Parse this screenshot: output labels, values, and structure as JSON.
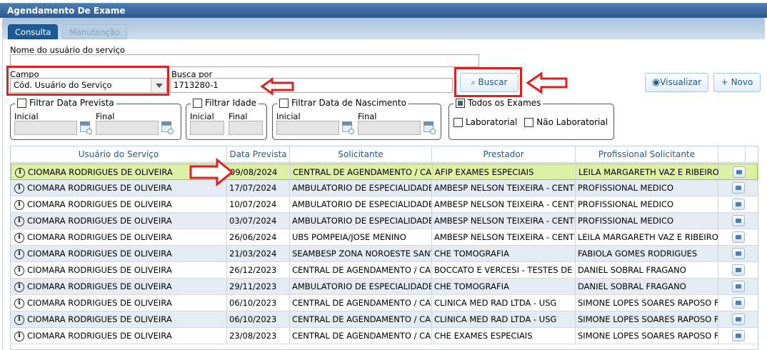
{
  "window": {
    "title": "Agendamento De Exame"
  },
  "tabs": [
    {
      "label": "Consulta"
    },
    {
      "label": "Manutenção"
    }
  ],
  "form": {
    "user_name_label": "Nome do usuário do serviço",
    "user_name_value": "",
    "campo_label": "Campo",
    "campo_value": "Cód. Usuário do Serviço",
    "busca_label": "Busca por",
    "busca_value": "1713280-1",
    "buscar_button": "Buscar",
    "visualizar_button": "Visualizar",
    "novo_button": "Novo"
  },
  "filters": {
    "data_prevista": {
      "label": "Filtrar Data Prevista",
      "inicial": "Inicial",
      "final": "Final"
    },
    "idade": {
      "label": "Filtrar Idade",
      "inicial": "Inicial",
      "final": "Final"
    },
    "nascimento": {
      "label": "Filtrar Data de Nascimento",
      "inicial": "Inicial",
      "final": "Final"
    },
    "exames": {
      "label": "Todos os Exames",
      "laboratorial": "Laboratorial",
      "nao_laboratorial": "Não Laboratorial"
    }
  },
  "table": {
    "columns": [
      "Usuário do Serviço",
      "Data Prevista",
      "Solicitante",
      "Prestador",
      "Profissional Solicitante"
    ],
    "rows": [
      [
        "CIOMARA RODRIGUES DE OLIVEIRA",
        "09/08/2024",
        "CENTRAL DE AGENDAMENTO / CALL",
        "AFIP EXAMES ESPECIAIS",
        "LEILA MARGARETH VAZ E RIBEIRO"
      ],
      [
        "CIOMARA RODRIGUES DE OLIVEIRA",
        "17/07/2024",
        "AMBULATORIO DE ESPECIALIDADES",
        "AMBESP NELSON TEIXEIRA - CENTR",
        "PROFISSIONAL MEDICO"
      ],
      [
        "CIOMARA RODRIGUES DE OLIVEIRA",
        "10/07/2024",
        "AMBULATORIO DE ESPECIALIDADES",
        "AMBESP NELSON TEIXEIRA - CENTR",
        "PROFISSIONAL MEDICO"
      ],
      [
        "CIOMARA RODRIGUES DE OLIVEIRA",
        "03/07/2024",
        "AMBULATORIO DE ESPECIALIDADES",
        "AMBESP NELSON TEIXEIRA - CENTR",
        "PROFISSIONAL MEDICO"
      ],
      [
        "CIOMARA RODRIGUES DE OLIVEIRA",
        "26/06/2024",
        "UBS POMPEIA/JOSE MENINO",
        "AMBESP NELSON TEIXEIRA - CENTR",
        "LEILA MARGARETH VAZ E RIBEIRO"
      ],
      [
        "CIOMARA RODRIGUES DE OLIVEIRA",
        "21/03/2024",
        "SEAMBESP ZONA NOROESTE SANTO",
        "CHE TOMOGRAFIA",
        "FABIOLA GOMES RODRIGUES"
      ],
      [
        "CIOMARA RODRIGUES DE OLIVEIRA",
        "26/12/2023",
        "CENTRAL DE AGENDAMENTO / CALL",
        "BOCCATO E VERCESI - TESTES DE A",
        "DANIEL SOBRAL FRAGANO"
      ],
      [
        "CIOMARA RODRIGUES DE OLIVEIRA",
        "29/11/2023",
        "AMBULATORIO DE ESPECIALIDADES",
        "CHE TOMOGRAFIA",
        "DANIEL SOBRAL FRAGANO"
      ],
      [
        "CIOMARA RODRIGUES DE OLIVEIRA",
        "06/10/2023",
        "CENTRAL DE AGENDAMENTO / CALL",
        "CLINICA MED RAD LTDA - USG",
        "SIMONE LOPES SOARES RAPOSO FE"
      ],
      [
        "CIOMARA RODRIGUES DE OLIVEIRA",
        "06/10/2023",
        "CENTRAL DE AGENDAMENTO / CALL",
        "CLINICA MED RAD LTDA - USG",
        "SIMONE LOPES SOARES RAPOSO FE"
      ],
      [
        "CIOMARA RODRIGUES DE OLIVEIRA",
        "23/08/2023",
        "CENTRAL DE AGENDAMENTO / CALL",
        "CHE EXAMES ESPECIAIS",
        "SIMONE LOPES SOARES RAPOSO FE"
      ]
    ]
  },
  "colors": {
    "accent": "#1d5b95",
    "highlight_row": "#dff0a6",
    "annotation": "#e01f1f"
  }
}
